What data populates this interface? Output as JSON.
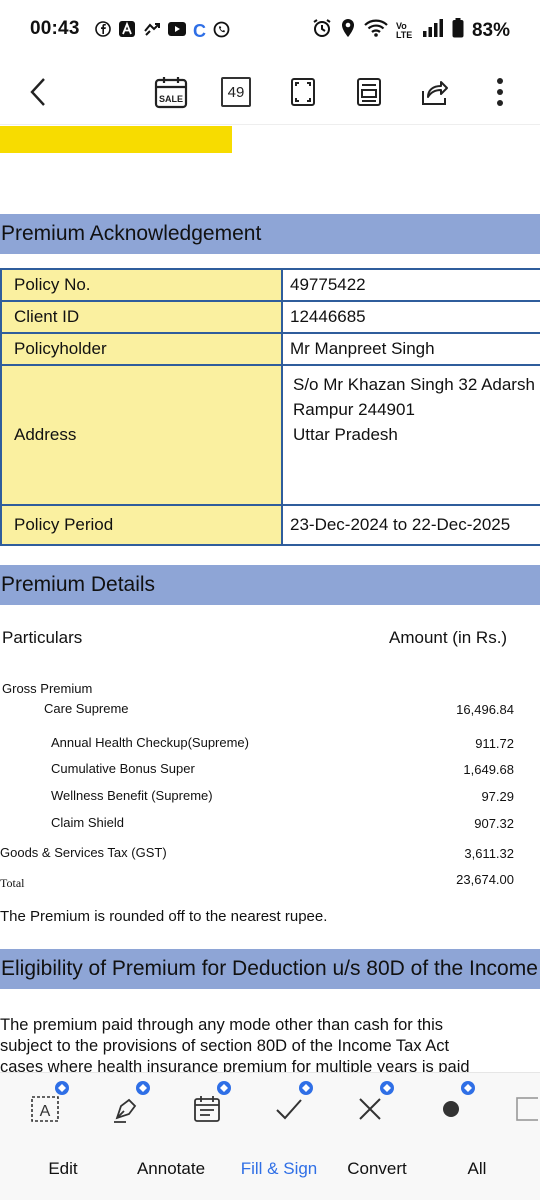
{
  "status_bar": {
    "time": "00:43",
    "battery_percent": "83%",
    "network_label": "Vo LTE"
  },
  "toolbar": {
    "page_count": "49"
  },
  "document": {
    "ack_title": "Premium Acknowledgement",
    "policy_no_label": "Policy No.",
    "policy_no": "49775422",
    "client_id_label": "Client ID",
    "client_id": "12446685",
    "policyholder_label": "Policyholder",
    "policyholder": "Mr Manpreet Singh",
    "address_label": "Address",
    "address_line1": "S/o Mr Khazan Singh 32 Adarsh",
    "address_line2": "Rampur 244901",
    "address_line3": "Uttar Pradesh",
    "policy_period_label": "Policy Period",
    "policy_period": "23-Dec-2024 to 22-Dec-2025",
    "premium_title": "Premium Details",
    "particulars_label": "Particulars",
    "amount_label": "Amount (in Rs.)",
    "gross_premium_label": "Gross Premium",
    "items": [
      {
        "name": "Care Supreme",
        "amount": "16,496.84"
      },
      {
        "name": "Annual Health Checkup(Supreme)",
        "amount": "911.72"
      },
      {
        "name": "Cumulative Bonus Super",
        "amount": "1,649.68"
      },
      {
        "name": "Wellness Benefit (Supreme)",
        "amount": "97.29"
      },
      {
        "name": "Claim Shield",
        "amount": "907.32"
      }
    ],
    "gst_label": "Goods & Services Tax (GST)",
    "gst_amount": "3,611.32",
    "total_label": "Total",
    "total_amount": "23,674.00",
    "rounded_note": "The Premium is rounded off to the nearest rupee.",
    "eligibility_title": "Eligibility of Premium for Deduction u/s 80D of the Income",
    "para_line1": "The premium paid through any mode other than cash for this",
    "para_line2": "subject to the provisions of section 80D of the Income Tax Act",
    "para_line3": "cases where health insurance premium for multiple years is paid"
  },
  "bottom_bar": {
    "edit": "Edit",
    "annotate": "Annotate",
    "fill_sign": "Fill & Sign",
    "convert": "Convert",
    "all": "All"
  },
  "colors": {
    "section_bar": "#8ea5d6",
    "label_cell": "#faf0a0",
    "table_border": "#2f5d9c",
    "highlight": "#f7dc00",
    "accent_active": "#2f6fe6"
  }
}
